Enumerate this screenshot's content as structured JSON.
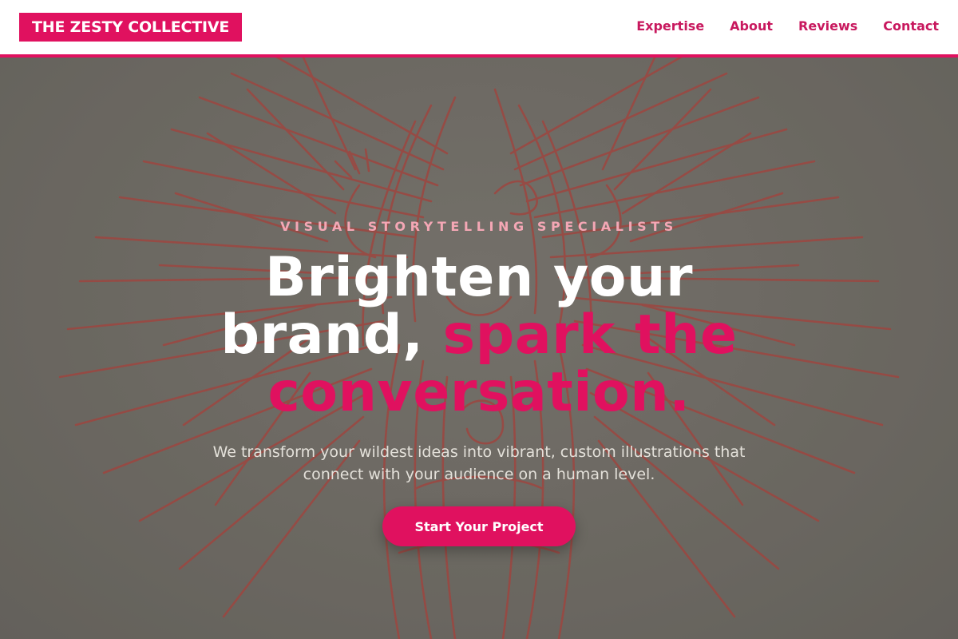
{
  "header": {
    "logo_text": "THE ZESTY COLLECTIVE",
    "nav": [
      {
        "label": "Expertise"
      },
      {
        "label": "About"
      },
      {
        "label": "Reviews"
      },
      {
        "label": "Contact"
      }
    ]
  },
  "hero": {
    "eyebrow": "VISUAL STORYTELLING SPECIALISTS",
    "headline_part1": "Brighten your brand, ",
    "headline_accent": "spark the conversation.",
    "subtext": "We transform your wildest ideas into vibrant, custom illustrations that connect with your audience on a human level.",
    "cta_label": "Start Your Project",
    "background_image": "red-ink-angel-engraving"
  },
  "colors": {
    "accent": "#e0115f",
    "nav_text": "#c8185e",
    "eyebrow": "#f4a7b5",
    "hero_background": "#76736b",
    "illustration_ink": "#b34a42"
  }
}
